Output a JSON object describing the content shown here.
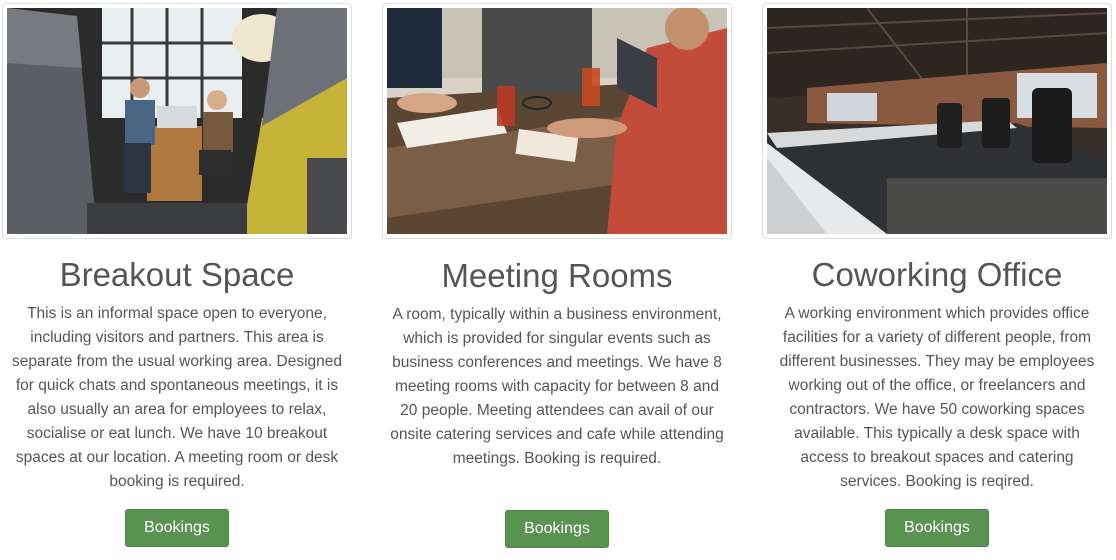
{
  "cards": [
    {
      "title": "Breakout Space",
      "image_alt": "breakout-space-photo",
      "description": "This is an informal space open to everyone, including visitors and partners. This area is separate from the usual working area. Designed for quick chats and spontaneous meetings, it is also usually an area for employees to relax, socialise or eat lunch. We have 10 breakout spaces at our location. A meeting room or desk booking is required.",
      "button_label": "Bookings »"
    },
    {
      "title": "Meeting Rooms",
      "image_alt": "meeting-rooms-photo",
      "description": "A room, typically within a business environment, which is provided for singular events such as business conferences and meetings. We have 8 meeting rooms with capacity for between 8 and 20 people. Meeting attendees can avail of our onsite catering services and cafe while attending meetings. Booking is required.",
      "button_label": "Bookings »"
    },
    {
      "title": "Coworking Office",
      "image_alt": "coworking-office-photo",
      "description": "A working environment which provides office facilities for a variety of different people, from different businesses. They may be employees working out of the office, or freelancers and contractors. We have 50 coworking spaces available. This typically a desk space with access to breakout spaces and catering services. Booking is reqired.",
      "button_label": "Bookings »"
    }
  ],
  "colors": {
    "button_bg": "#5a9251",
    "text": "#555555",
    "thumb_border": "#dddddd"
  }
}
